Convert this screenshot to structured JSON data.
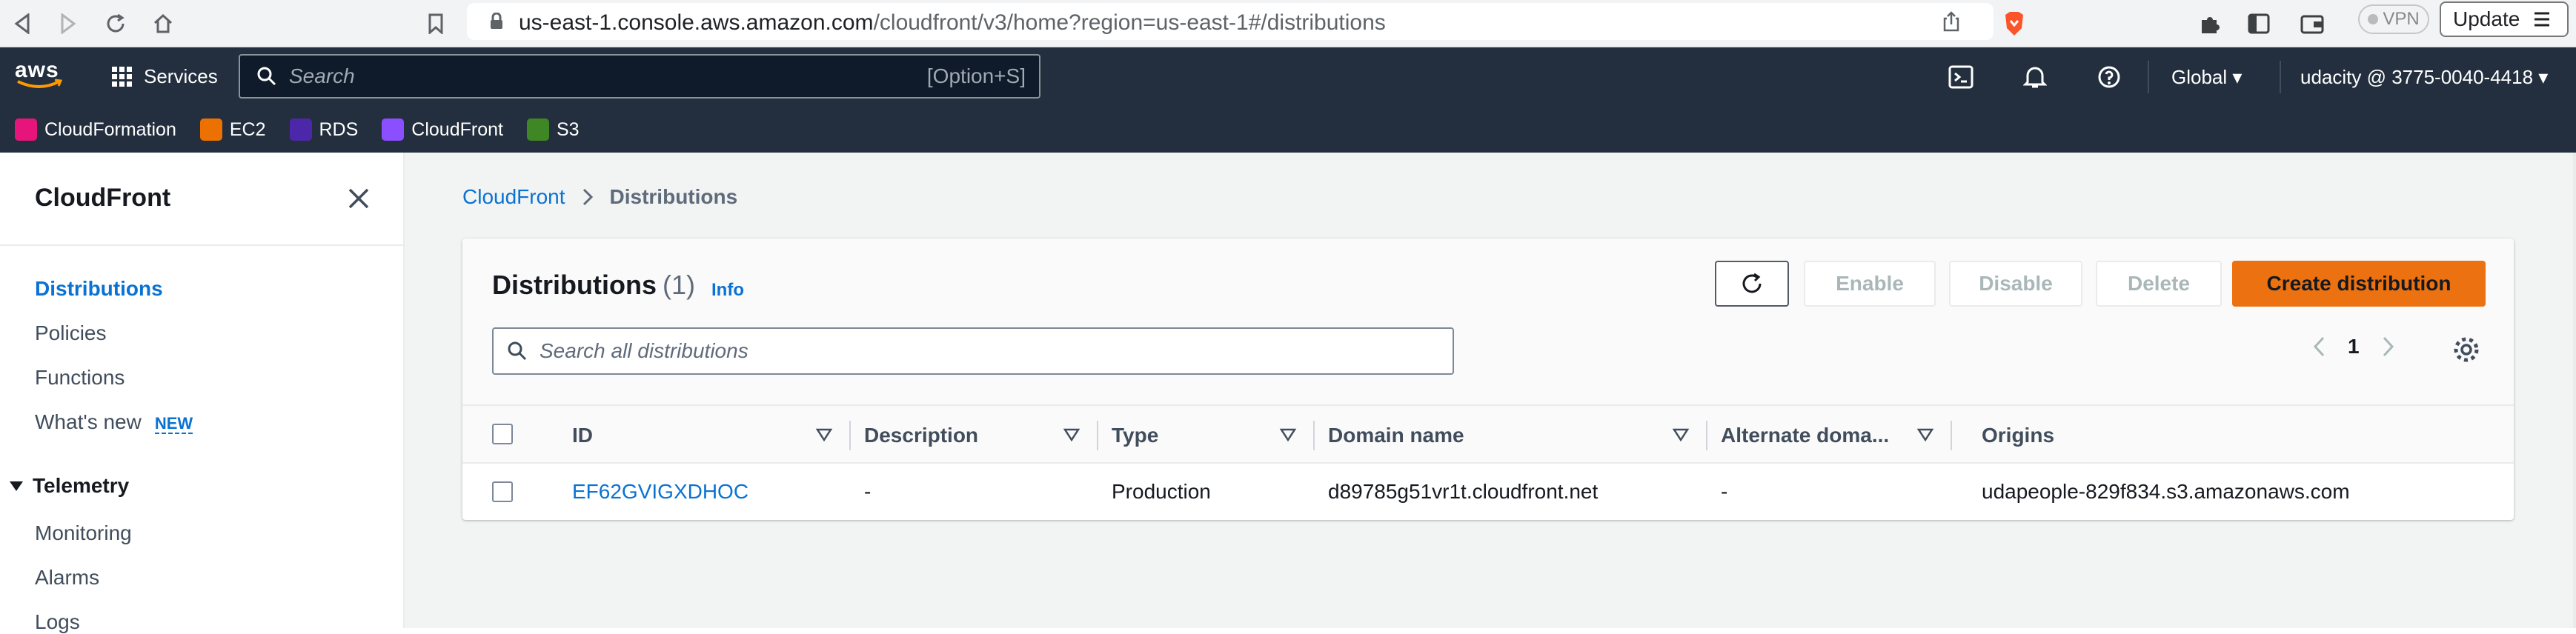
{
  "browser": {
    "url_host": "us-east-1.console.aws.amazon.com",
    "url_path": "/cloudfront/v3/home?region=us-east-1#/distributions",
    "vpn_label": "VPN",
    "update_label": "Update"
  },
  "aws": {
    "logo": "aws",
    "services_label": "Services",
    "search_placeholder": "Search",
    "search_shortcut": "[Option+S]",
    "region": "Global ▾",
    "account": "udacity @ 3775-0040-4418 ▾",
    "favorites": [
      {
        "label": "CloudFormation",
        "color": "#e7157b"
      },
      {
        "label": "EC2",
        "color": "#ed7100"
      },
      {
        "label": "RDS",
        "color": "#4d27aa"
      },
      {
        "label": "CloudFront",
        "color": "#8c4fff"
      },
      {
        "label": "S3",
        "color": "#3f8624"
      }
    ]
  },
  "sidebar": {
    "title": "CloudFront",
    "items": [
      {
        "label": "Distributions",
        "active": true
      },
      {
        "label": "Policies"
      },
      {
        "label": "Functions"
      },
      {
        "label": "What's new"
      }
    ],
    "new_badge": "NEW",
    "telemetry": {
      "label": "Telemetry",
      "items": [
        {
          "label": "Monitoring"
        },
        {
          "label": "Alarms"
        },
        {
          "label": "Logs"
        }
      ]
    }
  },
  "breadcrumb": {
    "root": "CloudFront",
    "current": "Distributions"
  },
  "panel": {
    "title": "Distributions",
    "count": "(1)",
    "info": "Info",
    "buttons": {
      "enable": "Enable",
      "disable": "Disable",
      "delete": "Delete",
      "create": "Create distribution"
    },
    "search_placeholder": "Search all distributions",
    "page": "1"
  },
  "table": {
    "columns": [
      "ID",
      "Description",
      "Type",
      "Domain name",
      "Alternate doma...",
      "Origins"
    ],
    "rows": [
      {
        "id": "EF62GVIGXDHOC",
        "description": "-",
        "type": "Production",
        "domain": "d89785g51vr1t.cloudfront.net",
        "alternate": "-",
        "origins": "udapeople-829f834.s3.amazonaws.com"
      }
    ]
  },
  "colors": {
    "header_bg": "#232f3e",
    "accent_link": "#0972d3",
    "primary_button": "#ec7211"
  }
}
